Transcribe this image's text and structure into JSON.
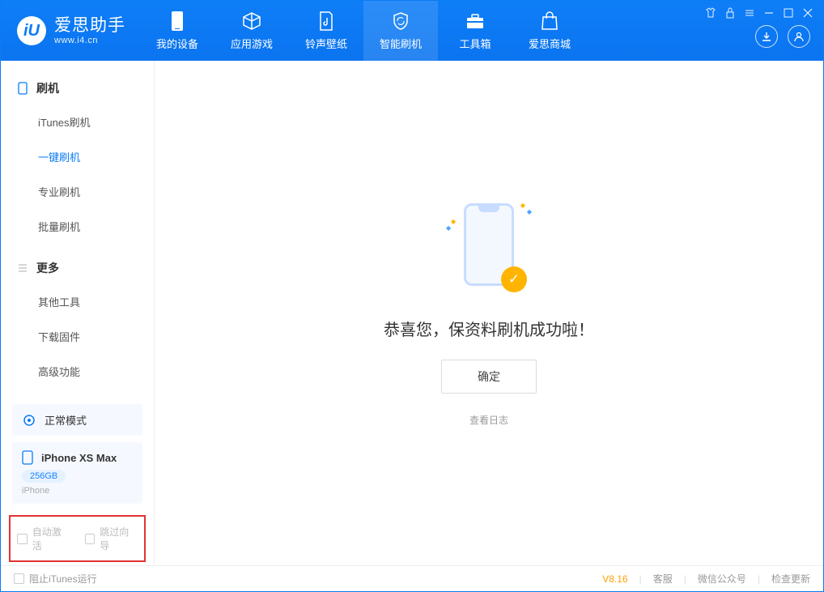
{
  "app": {
    "name": "爱思助手",
    "url": "www.i4.cn"
  },
  "nav": {
    "tabs": [
      {
        "label": "我的设备"
      },
      {
        "label": "应用游戏"
      },
      {
        "label": "铃声壁纸"
      },
      {
        "label": "智能刷机"
      },
      {
        "label": "工具箱"
      },
      {
        "label": "爱思商城"
      }
    ],
    "activeIndex": 3
  },
  "sidebar": {
    "section1": {
      "title": "刷机",
      "items": [
        {
          "label": "iTunes刷机"
        },
        {
          "label": "一键刷机"
        },
        {
          "label": "专业刷机"
        },
        {
          "label": "批量刷机"
        }
      ],
      "activeIndex": 1
    },
    "section2": {
      "title": "更多",
      "items": [
        {
          "label": "其他工具"
        },
        {
          "label": "下载固件"
        },
        {
          "label": "高级功能"
        }
      ]
    },
    "mode": {
      "label": "正常模式"
    },
    "device": {
      "name": "iPhone XS Max",
      "storage": "256GB",
      "type": "iPhone"
    },
    "options": {
      "autoActivate": "自动激活",
      "skipGuide": "跳过向导"
    }
  },
  "main": {
    "success": "恭喜您，保资料刷机成功啦！",
    "confirm": "确定",
    "viewLog": "查看日志"
  },
  "footer": {
    "blockItunes": "阻止iTunes运行",
    "version": "V8.16",
    "support": "客服",
    "wechat": "微信公众号",
    "update": "检查更新"
  }
}
